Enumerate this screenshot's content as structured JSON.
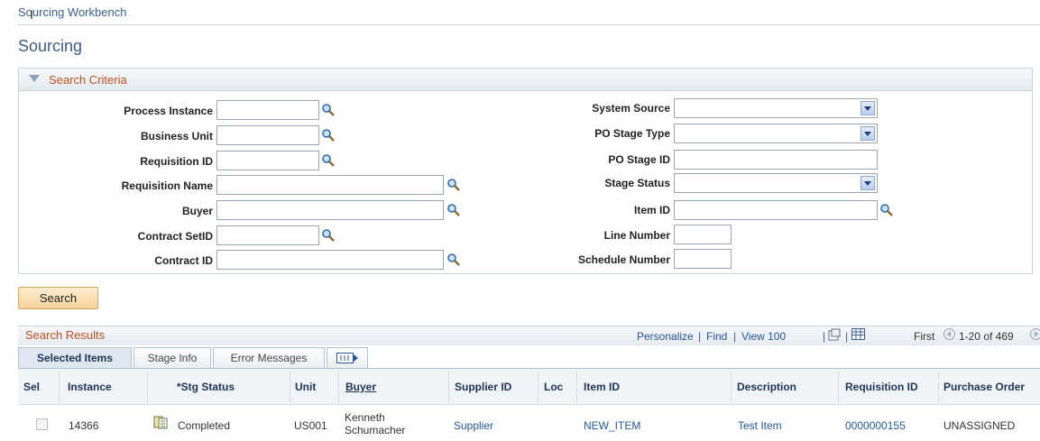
{
  "breadcrumb": "Sourcing Workbench",
  "page_title": "Sourcing",
  "criteria": {
    "title": "Search Criteria",
    "left_labels": [
      "Process Instance",
      "Business Unit",
      "Requisition ID",
      "Requisition Name",
      "Buyer",
      "Contract SetID",
      "Contract ID"
    ],
    "right_labels": [
      "System Source",
      "PO Stage Type",
      "PO Stage ID",
      "Stage Status",
      "Item ID",
      "Line Number",
      "Schedule Number"
    ]
  },
  "search_button": "Search",
  "results": {
    "title": "Search Results",
    "tools": {
      "personalize": "Personalize",
      "find": "Find",
      "view": "View 100",
      "first": "First",
      "range": "1-20 of 469"
    },
    "tabs": [
      "Selected Items",
      "Stage Info",
      "Error Messages"
    ],
    "columns": [
      "Sel",
      "Instance",
      "*Stg Status",
      "Unit",
      "Buyer",
      "Supplier ID",
      "Loc",
      "Item ID",
      "Description",
      "Requisition ID",
      "Purchase Order"
    ],
    "rows": [
      {
        "instance": "14366",
        "stg_status": "Completed",
        "unit": "US001",
        "buyer_line1": "Kenneth",
        "buyer_line2": "Schumacher",
        "supplier_id": "Supplier",
        "loc": "",
        "item_id": "NEW_ITEM",
        "description": "Test Item",
        "requisition_id": "0000000155",
        "purchase_order": "UNASSIGNED"
      }
    ]
  },
  "colors": {
    "accent_orange": "#c2501d",
    "link_blue": "#2356a3",
    "header_blue": "#3c5b8c"
  },
  "icons": [
    "lookup-icon",
    "dropdown-arrow-icon",
    "previous-arrow-icon",
    "zoom-icon",
    "download-icon",
    "show-all-columns-icon",
    "stage-details-icon"
  ]
}
